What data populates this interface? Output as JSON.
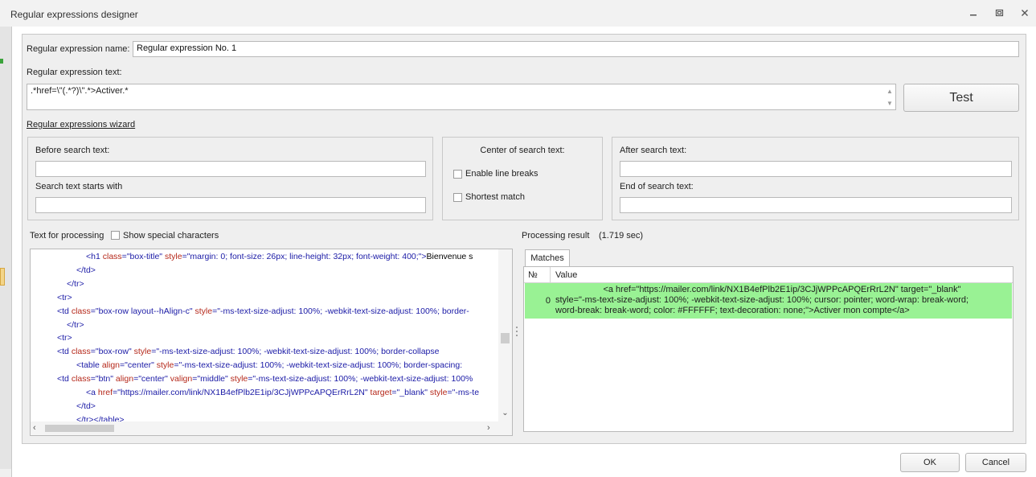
{
  "window": {
    "title": "Regular expressions designer"
  },
  "form": {
    "name_label": "Regular expression name:",
    "name_value": "Regular expression No. 1",
    "text_label": "Regular expression text:",
    "regex_value": ".*href=\\\"(.*?)\\\".*>Activer.*",
    "test_label": "Test",
    "wizard_link": "Regular expressions wizard"
  },
  "wizard": {
    "before_label": "Before search text:",
    "before_value": "",
    "starts_label": "Search text starts with",
    "starts_value": "",
    "center_label": "Center of search text:",
    "line_breaks_label": "Enable line breaks",
    "line_breaks_checked": false,
    "shortest_label": "Shortest match",
    "shortest_checked": false,
    "after_label": "After search text:",
    "after_value": "",
    "end_label": "End of search text:",
    "end_value": ""
  },
  "processing": {
    "label": "Text for processing",
    "special_chars_label": "Show special characters",
    "special_chars_checked": false,
    "lines": [
      {
        "indent": 3,
        "tokens": [
          [
            "tag",
            "<h1 "
          ],
          [
            "attr",
            "class"
          ],
          [
            "tag",
            "="
          ],
          [
            "val",
            "\"box-title\""
          ],
          [
            "tag",
            " "
          ],
          [
            "attr",
            "style"
          ],
          [
            "tag",
            "="
          ],
          [
            "val",
            "\"margin: 0; font-size: 26px; line-height: 32px; font-weight: 400;\""
          ],
          [
            "tag",
            ">"
          ],
          [
            "tx",
            "Bienvenue s"
          ]
        ]
      },
      {
        "indent": 2,
        "tokens": [
          [
            "tag",
            "</td>"
          ]
        ]
      },
      {
        "indent": 1,
        "tokens": [
          [
            "tag",
            "</tr>"
          ]
        ]
      },
      {
        "indent": 0,
        "tokens": [
          [
            "tag",
            "<tr>"
          ]
        ]
      },
      {
        "indent": 0,
        "tokens": [
          [
            "tag",
            "<td "
          ],
          [
            "attr",
            "class"
          ],
          [
            "tag",
            "="
          ],
          [
            "val",
            "\"box-row layout--hAlign-c\""
          ],
          [
            "tag",
            " "
          ],
          [
            "attr",
            "style"
          ],
          [
            "tag",
            "="
          ],
          [
            "val",
            "\"-ms-text-size-adjust: 100%; -webkit-text-size-adjust: 100%; border-"
          ]
        ]
      },
      {
        "indent": 1,
        "tokens": [
          [
            "tag",
            "</tr>"
          ]
        ]
      },
      {
        "indent": 0,
        "tokens": [
          [
            "tag",
            "<tr>"
          ]
        ]
      },
      {
        "indent": 0,
        "tokens": [
          [
            "tag",
            "<td "
          ],
          [
            "attr",
            "class"
          ],
          [
            "tag",
            "="
          ],
          [
            "val",
            "\"box-row\""
          ],
          [
            "tag",
            " "
          ],
          [
            "attr",
            "style"
          ],
          [
            "tag",
            "="
          ],
          [
            "val",
            "\"-ms-text-size-adjust: 100%; -webkit-text-size-adjust: 100%; border-collapse"
          ]
        ]
      },
      {
        "indent": 2,
        "tokens": [
          [
            "tag",
            "<table "
          ],
          [
            "attr",
            "align"
          ],
          [
            "tag",
            "="
          ],
          [
            "val",
            "\"center\""
          ],
          [
            "tag",
            " "
          ],
          [
            "attr",
            "style"
          ],
          [
            "tag",
            "="
          ],
          [
            "val",
            "\"-ms-text-size-adjust: 100%; -webkit-text-size-adjust: 100%; border-spacing:"
          ]
        ]
      },
      {
        "indent": 0,
        "tokens": [
          [
            "tag",
            "<td "
          ],
          [
            "attr",
            "class"
          ],
          [
            "tag",
            "="
          ],
          [
            "val",
            "\"btn\""
          ],
          [
            "tag",
            " "
          ],
          [
            "attr",
            "align"
          ],
          [
            "tag",
            "="
          ],
          [
            "val",
            "\"center\""
          ],
          [
            "tag",
            " "
          ],
          [
            "attr",
            "valign"
          ],
          [
            "tag",
            "="
          ],
          [
            "val",
            "\"middle\""
          ],
          [
            "tag",
            " "
          ],
          [
            "attr",
            "style"
          ],
          [
            "tag",
            "="
          ],
          [
            "val",
            "\"-ms-text-size-adjust: 100%; -webkit-text-size-adjust: 100%"
          ]
        ]
      },
      {
        "indent": 3,
        "tokens": [
          [
            "tag",
            "<a "
          ],
          [
            "attr",
            "href"
          ],
          [
            "tag",
            "="
          ],
          [
            "val",
            "\"https://mailer.com/link/NX1B4efPlb2E1ip/3CJjWPPcAPQErRrL2N\""
          ],
          [
            "tag",
            " "
          ],
          [
            "attr",
            "target"
          ],
          [
            "tag",
            "="
          ],
          [
            "val",
            "\"_blank\""
          ],
          [
            "tag",
            " "
          ],
          [
            "attr",
            "style"
          ],
          [
            "tag",
            "="
          ],
          [
            "val",
            "\"-ms-te"
          ]
        ]
      },
      {
        "indent": 2,
        "tokens": [
          [
            "tag",
            "</td>"
          ]
        ]
      },
      {
        "indent": 2,
        "tokens": [
          [
            "tag",
            "</tr></table>"
          ]
        ]
      }
    ]
  },
  "result": {
    "label": "Processing result",
    "time": "(1.719 sec)",
    "tab_label": "Matches",
    "col_no": "№",
    "col_value": "Value",
    "rows": [
      {
        "no": "0",
        "value_lines": [
          "<a href=\"https://mailer.com/link/NX1B4efPlb2E1ip/3CJjWPPcAPQErRrL2N\" target=\"_blank\"",
          "style=\"-ms-text-size-adjust: 100%; -webkit-text-size-adjust: 100%; cursor: pointer; word-wrap: break-word;",
          "word-break: break-word; color: #FFFFFF; text-decoration: none;\">Activer mon compte</a>"
        ]
      }
    ]
  },
  "buttons": {
    "ok": "OK",
    "cancel": "Cancel"
  },
  "colors": {
    "match_highlight": "#99f294",
    "tag": "#1a1aa6",
    "attribute": "#b5281a"
  }
}
